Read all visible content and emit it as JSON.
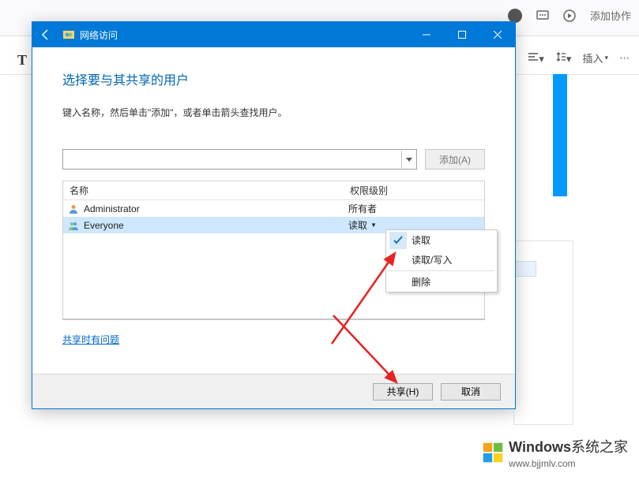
{
  "host": {
    "addaction": "添加协作",
    "insert": "插入"
  },
  "dialog": {
    "window_title": "网络访问",
    "heading": "选择要与其共享的用户",
    "instruction": "键入名称，然后单击\"添加\"，或者单击箭头查找用户。",
    "add_button": "添加(A)",
    "name_input_value": "",
    "table": {
      "col_name": "名称",
      "col_level": "权限级别",
      "rows": [
        {
          "name": "Administrator",
          "level": "所有者",
          "selected": false,
          "icon": "user"
        },
        {
          "name": "Everyone",
          "level": "读取",
          "selected": true,
          "icon": "group"
        }
      ]
    },
    "perm_menu": {
      "read": "读取",
      "readwrite": "读取/写入",
      "remove": "删除"
    },
    "help_link": "共享时有问题",
    "share_button": "共享(H)",
    "cancel_button": "取消"
  },
  "watermark": {
    "brand": "Windows",
    "suffix": "系统之家",
    "url": "www.bjjmlv.com"
  }
}
